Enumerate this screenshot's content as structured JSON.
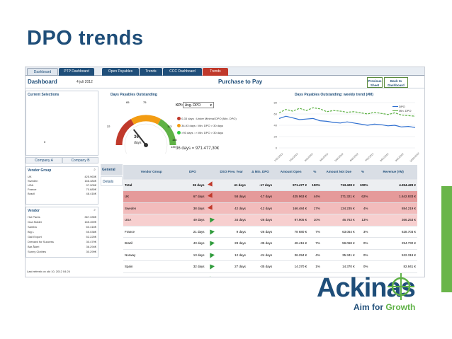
{
  "slide_title": "DPO trends",
  "tabs": [
    "Dashboard",
    "PTP Dashboard",
    "Open Payables",
    "Trends",
    "CCC Dashboard",
    "Trends"
  ],
  "header": {
    "title": "Dashboard",
    "date": "4 juli 2012",
    "center_title": "Purchase to Pay",
    "buttons": [
      "Previous Sheet",
      "Back to Dashboard"
    ]
  },
  "left": {
    "current_selections": "Current Selections",
    "company_tabs": [
      "Company A",
      "Company B"
    ],
    "vendor_group": {
      "label": "Vendor Group",
      "rows": [
        [
          "UK",
          "425.963€"
        ],
        [
          "Sweden",
          "166.484€"
        ],
        [
          "USA",
          "97.905€"
        ],
        [
          "France",
          "70.680€"
        ],
        [
          "Brazil",
          "48.416€"
        ]
      ]
    },
    "vendor": {
      "label": "Vendor",
      "rows": [
        [
          "Hot Pants",
          "367.335€"
        ],
        [
          "Goa Kläder",
          "165.459€"
        ],
        [
          "Samba",
          "60.416€"
        ],
        [
          "Big L",
          "55.038€"
        ],
        [
          "Gail Export",
          "52.225€"
        ],
        [
          "Dressed for Success",
          "30.479€"
        ],
        [
          "Bar Åkeri",
          "36.294€"
        ],
        [
          "Sunny Clothes",
          "30.299€"
        ]
      ]
    },
    "refresh": "Last refresh on okt 10, 2012 04:24"
  },
  "gauge": {
    "title": "Days Payables Outstanding",
    "value": "36",
    "unit": "days",
    "ticks": [
      "0",
      "22",
      "65",
      "75",
      "113",
      "135",
      "150"
    ],
    "value_num": 36,
    "max": 150
  },
  "kpi": {
    "label": "KPI:",
    "select": "Avg. DPO",
    "legend": [
      "0-33 days : Under Minimal DPO (Min. DPO)",
      "34-93 days : Min. DPO > 30 days",
      ">93 days : > Min. DPO > 30 days"
    ],
    "legend_colors": [
      "#c0392b",
      "#f39c12",
      "#2ecc40"
    ],
    "summary": "36 days  =  971.477,30€"
  },
  "trend": {
    "title": "Days Payables Outstanding: weekly trend (#M)",
    "legend": [
      "DPO",
      "Min. DPO"
    ]
  },
  "chart_data": {
    "type": "line",
    "x": [
      "1/01/2012",
      "2/01/2012",
      "3/01/2012",
      "4/01/2012",
      "5/01/2012",
      "6/01/2012",
      "7/01/2012",
      "8/01/2012",
      "9/01/2012",
      "10/01/2012"
    ],
    "series": [
      {
        "name": "DPO",
        "values": [
          52,
          56,
          53,
          50,
          51,
          52,
          48,
          47,
          45,
          44,
          46,
          44,
          42,
          40,
          42,
          41,
          39,
          40,
          37,
          38,
          36
        ],
        "color": "#2f6fd0"
      },
      {
        "name": "Min. DPO",
        "values": [
          62,
          68,
          65,
          70,
          66,
          71,
          69,
          64,
          66,
          65,
          63,
          64,
          62,
          60,
          63,
          61,
          59,
          62,
          58,
          57,
          56
        ],
        "color": "#5fb246"
      }
    ],
    "yticks": [
      "80",
      "60",
      "40",
      "20",
      "0"
    ],
    "ylim": [
      0,
      80
    ]
  },
  "grid": {
    "side_tabs": [
      "General",
      "Details"
    ],
    "columns": [
      "Vendor Group",
      "DPO",
      "",
      "DSO Prev. Year",
      "Δ Min. DPO",
      "Amount Open",
      "%",
      "Amount Not Due",
      "%",
      "Revenue (#M)"
    ],
    "rows": [
      {
        "name": "Total",
        "dpo": "36 days",
        "arrow": "down",
        "prev": "41 days",
        "delta": "-17 days",
        "open": "971.477 €",
        "p1": "100%",
        "notdue": "713.428 €",
        "p2": "100%",
        "rev": "4.354.429 €",
        "style": "total"
      },
      {
        "name": "UK",
        "dpo": "67 days",
        "arrow": "down",
        "prev": "58 days",
        "delta": "-17 days",
        "open": "425 963 €",
        "p1": "44%",
        "notdue": "271.321 €",
        "p2": "62%",
        "rev": "1.642.933 €",
        "style": "red"
      },
      {
        "name": "Sweden",
        "dpo": "38 days",
        "arrow": "down",
        "prev": "42 days",
        "delta": "-12 days",
        "open": "166.484 €",
        "p1": "17%",
        "notdue": "134.235 €",
        "p2": "4%",
        "rev": "884.219 €",
        "style": "pink"
      },
      {
        "name": "USA",
        "dpo": "49 days",
        "arrow": "up",
        "prev": "34 days",
        "delta": "-26 days",
        "open": "97.905 €",
        "p1": "10%",
        "notdue": "46.763 €",
        "p2": "13%",
        "rev": "366.253 €",
        "style": "pink2"
      },
      {
        "name": "France",
        "dpo": "21 days",
        "arrow": "up",
        "prev": "9 days",
        "delta": "-26 days",
        "open": "78 680 €",
        "p1": "7%",
        "notdue": "63.054 €",
        "p2": "3%",
        "rev": "628.703 €",
        "style": ""
      },
      {
        "name": "Brazil",
        "dpo": "43 days",
        "arrow": "up",
        "prev": "28 days",
        "delta": "-35 days",
        "open": "48.416 €",
        "p1": "7%",
        "notdue": "59.068 €",
        "p2": "0%",
        "rev": "254.732 €",
        "style": ""
      },
      {
        "name": "Norway",
        "dpo": "13 days",
        "arrow": "up",
        "prev": "12 days",
        "delta": "-24 days",
        "open": "36.294 €",
        "p1": "4%",
        "notdue": "35.341 €",
        "p2": "0%",
        "rev": "522.319 €",
        "style": ""
      },
      {
        "name": "Spain",
        "dpo": "32 days",
        "arrow": "up",
        "prev": "27 days",
        "delta": "-35 days",
        "open": "14.370 €",
        "p1": "1%",
        "notdue": "14.370 €",
        "p2": "0%",
        "rev": "82.941 €",
        "style": ""
      },
      {
        "name": "Germany",
        "dpo": "19 days",
        "arrow": "up",
        "prev": "37 days",
        "delta": "-27 days",
        "open": "14.509 €",
        "p1": "1%",
        "notdue": "14.019 €",
        "p2": "0%",
        "rev": "142.499 €",
        "style": ""
      }
    ]
  },
  "logo": {
    "brand": "Ackinas",
    "tagline_a": "Aim for ",
    "tagline_b": "Growth"
  }
}
